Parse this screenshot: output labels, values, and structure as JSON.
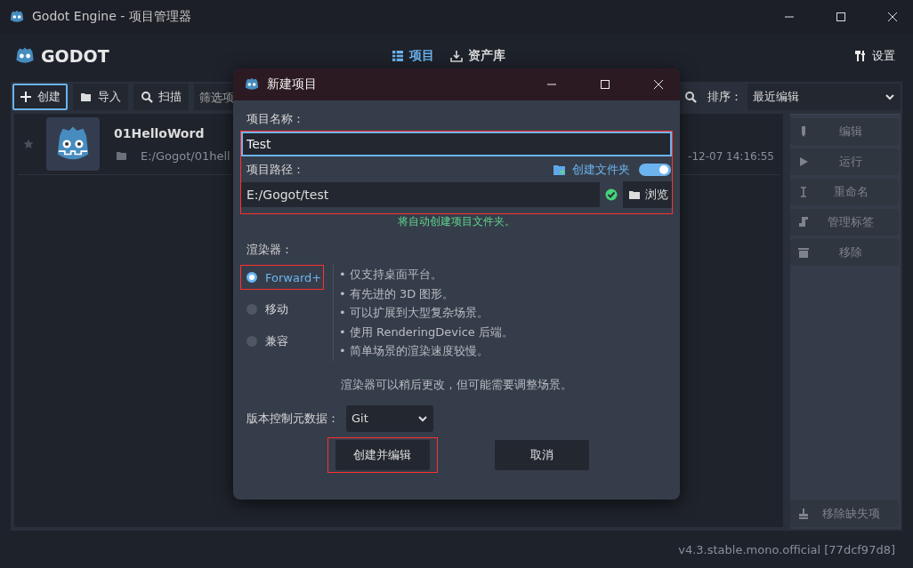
{
  "window": {
    "title": "Godot Engine - 项目管理器"
  },
  "header": {
    "logo": "GODOT",
    "tabs": [
      {
        "label": "项目",
        "selected": true
      },
      {
        "label": "资产库",
        "selected": false
      }
    ],
    "settings": "设置"
  },
  "toolbar": {
    "buttons": [
      {
        "kind": "create",
        "label": "创建",
        "selected": true
      },
      {
        "kind": "import",
        "label": "导入",
        "selected": false
      },
      {
        "kind": "scan",
        "label": "扫描",
        "selected": false
      }
    ],
    "filter_placeholder": "筛选项",
    "sort_label": "排序：",
    "sort_value": "最近编辑"
  },
  "projects": [
    {
      "name": "01HelloWord",
      "path": "E:/Gogot/01hell",
      "modified": "-12-07 14:16:55"
    }
  ],
  "actions": [
    {
      "kind": "edit",
      "label": "编辑",
      "disabled": true
    },
    {
      "kind": "run",
      "label": "运行",
      "disabled": true
    },
    {
      "kind": "rename",
      "label": "重命名",
      "disabled": true
    },
    {
      "kind": "tags",
      "label": "管理标签",
      "disabled": true
    },
    {
      "kind": "remove",
      "label": "移除",
      "disabled": true
    }
  ],
  "remove_missing": {
    "label": "移除缺失项",
    "disabled": true
  },
  "version": "v4.3.stable.mono.official [77dcf97d8]",
  "dialog": {
    "title": "新建项目",
    "inputs_highlighted": true,
    "name_label": "项目名称：",
    "name_value": "Test",
    "path_label": "项目路径：",
    "create_folder": {
      "label": "创建文件夹",
      "on": true
    },
    "path_value": "E:/Gogot/test",
    "path_valid": true,
    "browse": "浏览",
    "path_note": "将自动创建项目文件夹。",
    "renderer_label": "渲染器：",
    "renderers": [
      {
        "label": "Forward+",
        "selected": true,
        "highlighted": true
      },
      {
        "label": "移动",
        "selected": false,
        "highlighted": false
      },
      {
        "label": "兼容",
        "selected": false,
        "highlighted": false
      }
    ],
    "renderer_notes": [
      "•  仅支持桌面平台。",
      "•  有先进的 3D 图形。",
      "•  可以扩展到大型复杂场景。",
      "•  使用 RenderingDevice 后端。",
      "•  简单场景的渲染速度较慢。"
    ],
    "renderer_hint": "渲染器可以稍后更改，但可能需要调整场景。",
    "vcs_label": "版本控制元数据：",
    "vcs_value": "Git",
    "buttons": [
      {
        "label": "创建并编辑",
        "highlighted": true
      },
      {
        "label": "取消",
        "highlighted": false
      }
    ]
  }
}
